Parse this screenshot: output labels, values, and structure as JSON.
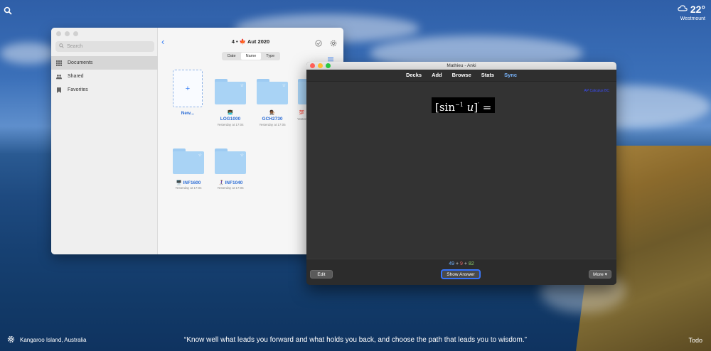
{
  "desktop": {
    "weather": {
      "temp": "22°",
      "location": "Westmount",
      "icon": "cloud-icon"
    },
    "location_caption": "Kangaroo Island, Australia",
    "quote": "“Know well what leads you forward and what holds you back, and choose the path that leads you to wisdom.”",
    "todo_label": "Todo"
  },
  "finder": {
    "search_placeholder": "Search",
    "sidebar": [
      {
        "label": "Documents",
        "icon": "grid-icon",
        "active": true
      },
      {
        "label": "Shared",
        "icon": "people-icon",
        "active": false
      },
      {
        "label": "Favorites",
        "icon": "bookmark-icon",
        "active": false
      }
    ],
    "title_prefix": "4 •",
    "title": "Aut 2020",
    "sort_options": [
      "Date",
      "Name",
      "Type"
    ],
    "sort_selected": "Name",
    "new_label": "New...",
    "folders": [
      {
        "name": "LOG1000",
        "date": "Yesterday at 17:04",
        "emoji": "👨🏾‍💻"
      },
      {
        "name": "GCH2730",
        "date": "Yesterday at 17:05",
        "emoji": "🧑🏾‍⚖️"
      },
      {
        "name": "",
        "date": "Yesterd",
        "emoji": "💯"
      },
      {
        "name": "INF1600",
        "date": "Yesterday at 17:04",
        "emoji": "🖥️"
      },
      {
        "name": "INF1040",
        "date": "Yesterday at 17:05",
        "emoji": "👩🏽‍🦯"
      }
    ]
  },
  "anki": {
    "window_title": "Mathieu - Anki",
    "toolbar": [
      "Decks",
      "Add",
      "Browse",
      "Stats",
      "Sync"
    ],
    "deck_tag": "AP Calculus BC",
    "formula_text": "sin",
    "formula_sup": "−1",
    "formula_var": "u",
    "counts": {
      "new": "49",
      "learn": "9",
      "review": "82",
      "sep": "+"
    },
    "edit_label": "Edit",
    "show_answer_label": "Show Answer",
    "more_label": "More ▾"
  }
}
